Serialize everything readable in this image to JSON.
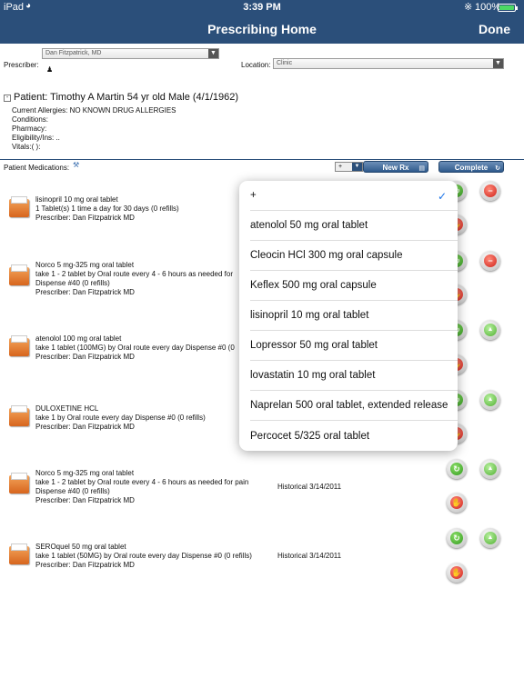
{
  "status": {
    "carrier": "iPad",
    "time": "3:39 PM",
    "battery": "100%",
    "battery_level": 1.0
  },
  "nav": {
    "title": "Prescribing Home",
    "done": "Done"
  },
  "form": {
    "prescriber_label": "Prescriber:",
    "prescriber_value": "Dan Fitzpatrick, MD",
    "location_label": "Location:",
    "location_value": "Clinic"
  },
  "patient": {
    "header": "Patient: Timothy A Martin 54 yr old Male (4/1/1962)",
    "allergies": "Current Allergies: NO KNOWN DRUG ALLERGIES",
    "conditions": "Conditions:",
    "pharmacy": "Pharmacy:",
    "eligibility": "Eligibility/Ins: ..",
    "vitals": "Vitals:( ):"
  },
  "meds_section": {
    "label": "Patient Medications:",
    "add_select_value": "+",
    "new_rx": "New Rx",
    "complete": "Complete"
  },
  "medications": [
    {
      "name": "lisinopril 10 mg oral tablet",
      "sig": "1 Tablet(s) 1 time a day for 30 days (0 refills)",
      "sig2": "",
      "prescriber": "Prescriber: Dan Fitzpatrick MD",
      "historical": ""
    },
    {
      "name": "Norco 5 mg-325 mg oral tablet",
      "sig": "take 1 - 2 tablet by Oral route every 4 - 6 hours as needed for",
      "sig2": "Dispense #40 (0 refills)",
      "prescriber": "Prescriber: Dan Fitzpatrick MD",
      "historical": ""
    },
    {
      "name": "atenolol 100 mg oral tablet",
      "sig": "take 1 tablet (100MG) by Oral route every day Dispense #0 (0",
      "sig2": "",
      "prescriber": "Prescriber: Dan Fitzpatrick MD",
      "historical": ""
    },
    {
      "name": "DULOXETINE HCL",
      "sig": "take 1 by Oral route every day Dispense #0 (0 refills)",
      "sig2": "",
      "prescriber": "Prescriber: Dan Fitzpatrick MD",
      "historical": ""
    },
    {
      "name": "Norco 5 mg-325 mg oral tablet",
      "sig": "take 1 - 2 tablet by Oral route every 4 - 6 hours as needed for pain",
      "sig2": "Dispense #40 (0 refills)",
      "prescriber": "Prescriber: Dan Fitzpatrick MD",
      "historical": "Historical 3/14/2011"
    },
    {
      "name": "SEROquel 50 mg oral tablet",
      "sig": "take 1 tablet (50MG) by Oral route every day Dispense #0 (0 refills)",
      "sig2": "",
      "prescriber": "Prescriber: Dan Fitzpatrick MD",
      "historical": "Historical 3/14/2011"
    }
  ],
  "popover": {
    "items": [
      "+",
      "atenolol 50 mg oral tablet",
      "Cleocin HCl 300 mg oral capsule",
      "Keflex 500 mg oral capsule",
      "lisinopril 10 mg oral tablet",
      "Lopressor 50 mg oral tablet",
      "lovastatin 10 mg oral tablet",
      "Naprelan 500 oral tablet, extended release",
      "Percocet 5/325 oral tablet"
    ],
    "selected_index": 0
  },
  "icons": {
    "accent": "#2b4f7a",
    "check_color": "#1a73e8"
  }
}
